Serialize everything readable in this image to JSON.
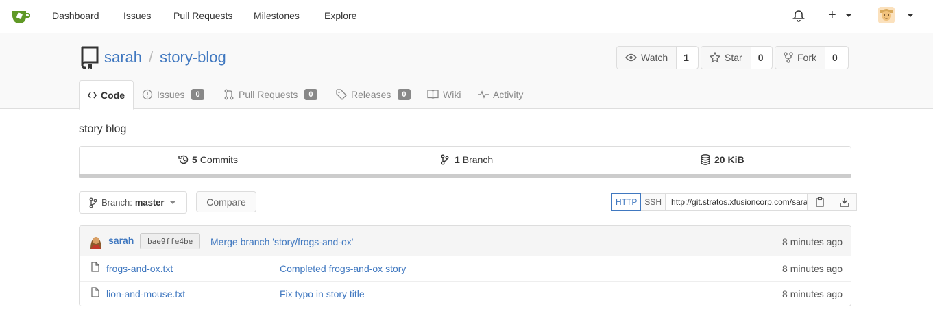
{
  "nav": {
    "items": [
      "Dashboard",
      "Issues",
      "Pull Requests",
      "Milestones",
      "Explore"
    ],
    "plus": "+"
  },
  "repo": {
    "owner": "sarah",
    "separator": "/",
    "name": "story-blog",
    "description": "story blog"
  },
  "actions": {
    "watch_label": "Watch",
    "watch_count": "1",
    "star_label": "Star",
    "star_count": "0",
    "fork_label": "Fork",
    "fork_count": "0"
  },
  "tabs": [
    {
      "label": "Code",
      "active": true
    },
    {
      "label": "Issues",
      "badge": "0"
    },
    {
      "label": "Pull Requests",
      "badge": "0"
    },
    {
      "label": "Releases",
      "badge": "0"
    },
    {
      "label": "Wiki"
    },
    {
      "label": "Activity"
    }
  ],
  "stats": {
    "commits_count": "5",
    "commits_label": "Commits",
    "branch_count": "1",
    "branch_label": "Branch",
    "size": "20 KiB"
  },
  "branch": {
    "prefix": "Branch:",
    "name": "master",
    "compare_label": "Compare"
  },
  "clone": {
    "http_label": "HTTP",
    "ssh_label": "SSH",
    "url": "http://git.stratos.xfusioncorp.com/sarah/story-blog.git"
  },
  "latest_commit": {
    "author": "sarah",
    "sha": "bae9ffe4be",
    "message": "Merge branch 'story/frogs-and-ox'",
    "time": "8 minutes ago"
  },
  "files": [
    {
      "name": "frogs-and-ox.txt",
      "message": "Completed frogs-and-ox story",
      "time": "8 minutes ago"
    },
    {
      "name": "lion-and-mouse.txt",
      "message": "Fix typo in story title",
      "time": "8 minutes ago"
    }
  ],
  "colors": {
    "link": "#4078c0",
    "logo": "#609926",
    "badge": "#888888"
  }
}
